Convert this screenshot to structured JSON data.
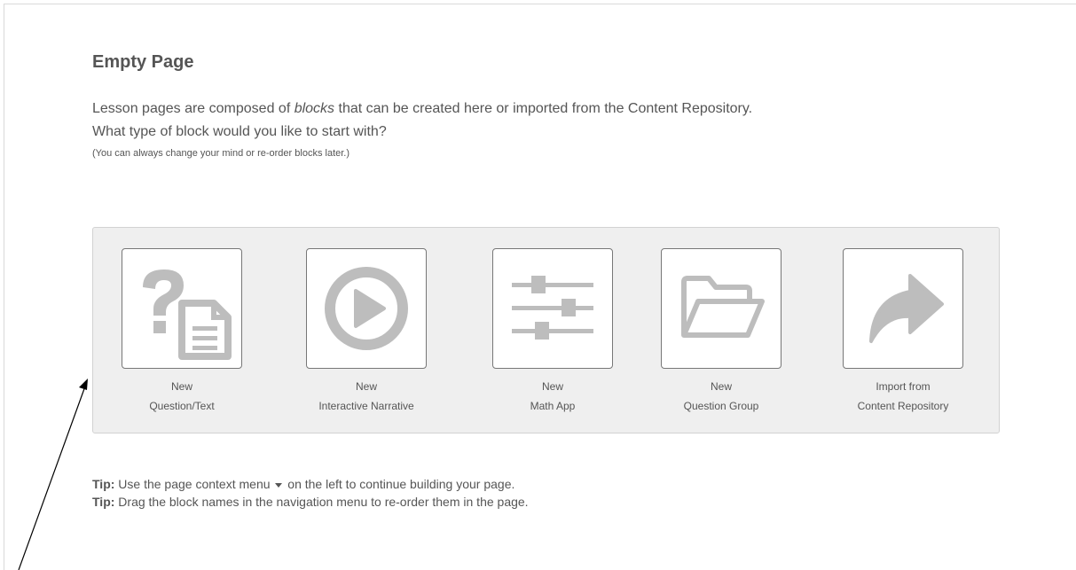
{
  "page": {
    "title": "Empty Page",
    "intro_before": "Lesson pages are composed of ",
    "intro_em": "blocks",
    "intro_after": " that can be created here or imported from the Content Repository.",
    "question": "What type of block would you like to start with?",
    "note": "(You can always change your mind or re-order blocks later.)"
  },
  "blocks": [
    {
      "line1": "New",
      "line2": "Question/Text",
      "icon": "question-document-icon"
    },
    {
      "line1": "New",
      "line2": "Interactive Narrative",
      "icon": "play-circle-icon"
    },
    {
      "line1": "New",
      "line2": "Math App",
      "icon": "sliders-icon"
    },
    {
      "line1": "New",
      "line2": "Question Group",
      "icon": "folder-open-icon"
    },
    {
      "line1": "Import from",
      "line2": "Content Repository",
      "icon": "share-arrow-icon"
    }
  ],
  "tips": [
    {
      "label": "Tip:",
      "before": " Use the page context menu ",
      "after": " on the left to continue building your page."
    },
    {
      "label": "Tip:",
      "text": " Drag the block names in the navigation menu to re-order them in the page."
    }
  ],
  "colors": {
    "icon": "#bdbdbd",
    "panel": "#efefef",
    "text": "#555555"
  }
}
